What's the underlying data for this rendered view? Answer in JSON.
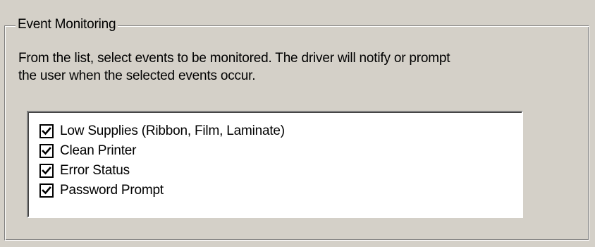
{
  "groupbox": {
    "title": "Event Monitoring"
  },
  "instructions": {
    "line1": "From the list, select events to be monitored.  The driver will notify or prompt",
    "line2": "the user when the selected events occur."
  },
  "events": {
    "items": [
      {
        "label": "Low Supplies (Ribbon, Film, Laminate)",
        "checked": true
      },
      {
        "label": "Clean Printer",
        "checked": true
      },
      {
        "label": "Error Status",
        "checked": true
      },
      {
        "label": "Password Prompt",
        "checked": true
      }
    ]
  },
  "colors": {
    "background": "#d4d0c8",
    "list_background": "#ffffff",
    "text": "#000000"
  }
}
